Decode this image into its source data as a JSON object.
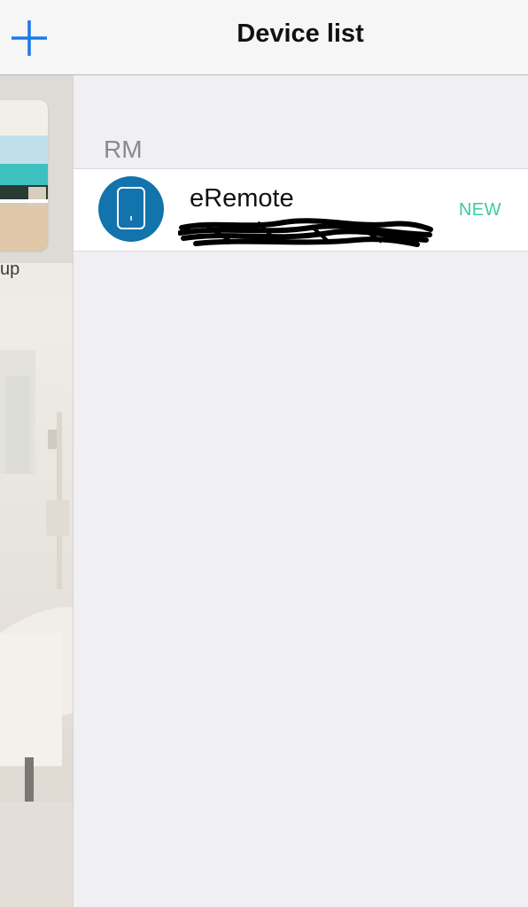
{
  "header": {
    "title": "Device list",
    "add_icon": "plus-icon",
    "accent": "#1a7ae8"
  },
  "sidebar": {
    "group_label": "up"
  },
  "device_section": {
    "header": "RM",
    "devices": [
      {
        "name": "eRemote",
        "badge": "NEW",
        "icon": "remote-device-icon",
        "icon_bg": "#1273ad",
        "badge_color": "#3ccba4"
      }
    ]
  }
}
